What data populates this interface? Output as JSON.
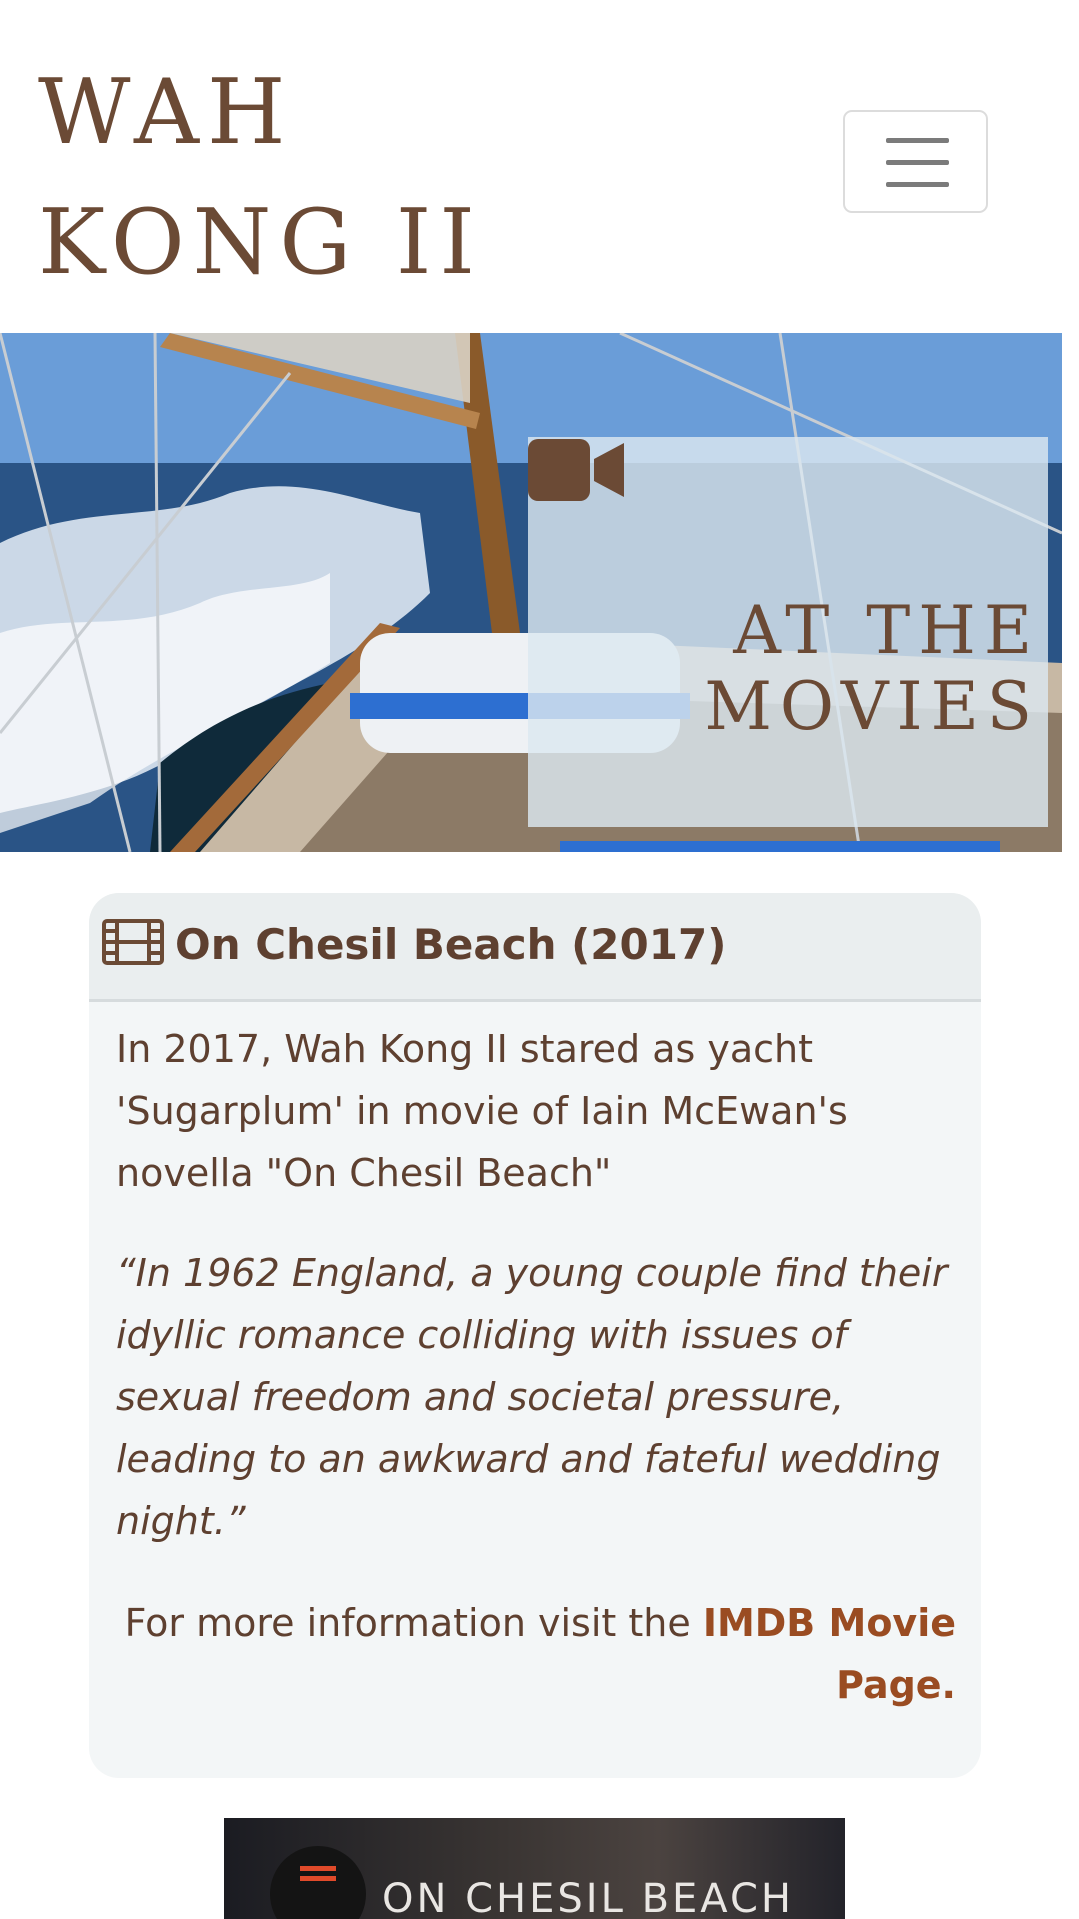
{
  "header": {
    "brand_line1": "WAH",
    "brand_line2": "KONG II",
    "menu_icon": "hamburger-icon"
  },
  "hero": {
    "icon": "video-camera-icon",
    "title_line1": "AT THE",
    "title_line2": "MOVIES"
  },
  "card": {
    "icon": "film-icon",
    "title": "On Chesil Beach (2017)",
    "text": "In 2017, Wah Kong II stared as yacht 'Sugarplum' in movie of Iain McEwan's novella \"On Chesil Beach\"",
    "quote": "“In 1962 England, a young couple find their idyllic romance colliding with issues of sexual freedom and societal pressure, leading to an awkward and fateful wedding night.”",
    "more_info_prefix": "For more information visit the ",
    "more_info_link": "IMDB Movie Page."
  },
  "video": {
    "title": "ON CHESIL BEACH"
  },
  "colors": {
    "brand_brown": "#6b4a35",
    "text_brown": "#5e4030",
    "link": "#9a4c22",
    "card_bg": "#f3f6f7",
    "card_header_bg": "#eaeeef"
  }
}
